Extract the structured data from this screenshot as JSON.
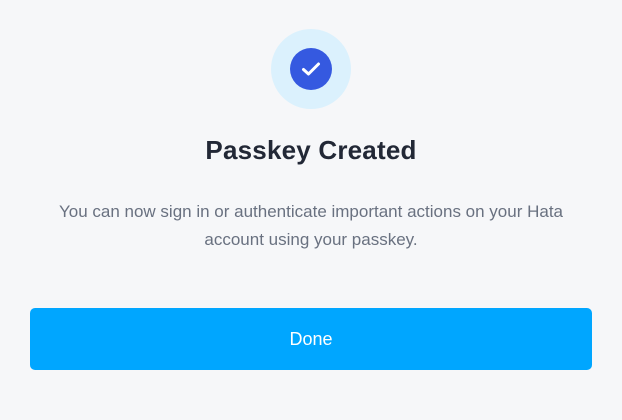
{
  "dialog": {
    "icon": "check-circle-icon",
    "title": "Passkey Created",
    "description": "You can now sign in or authenticate important actions on your Hata account using your passkey.",
    "done_label": "Done"
  },
  "colors": {
    "background": "#f6f7f9",
    "icon_halo": "#dbf1fd",
    "icon_fill": "#3559e0",
    "title": "#222836",
    "description": "#697180",
    "button": "#00a6ff",
    "button_text": "#ffffff"
  }
}
